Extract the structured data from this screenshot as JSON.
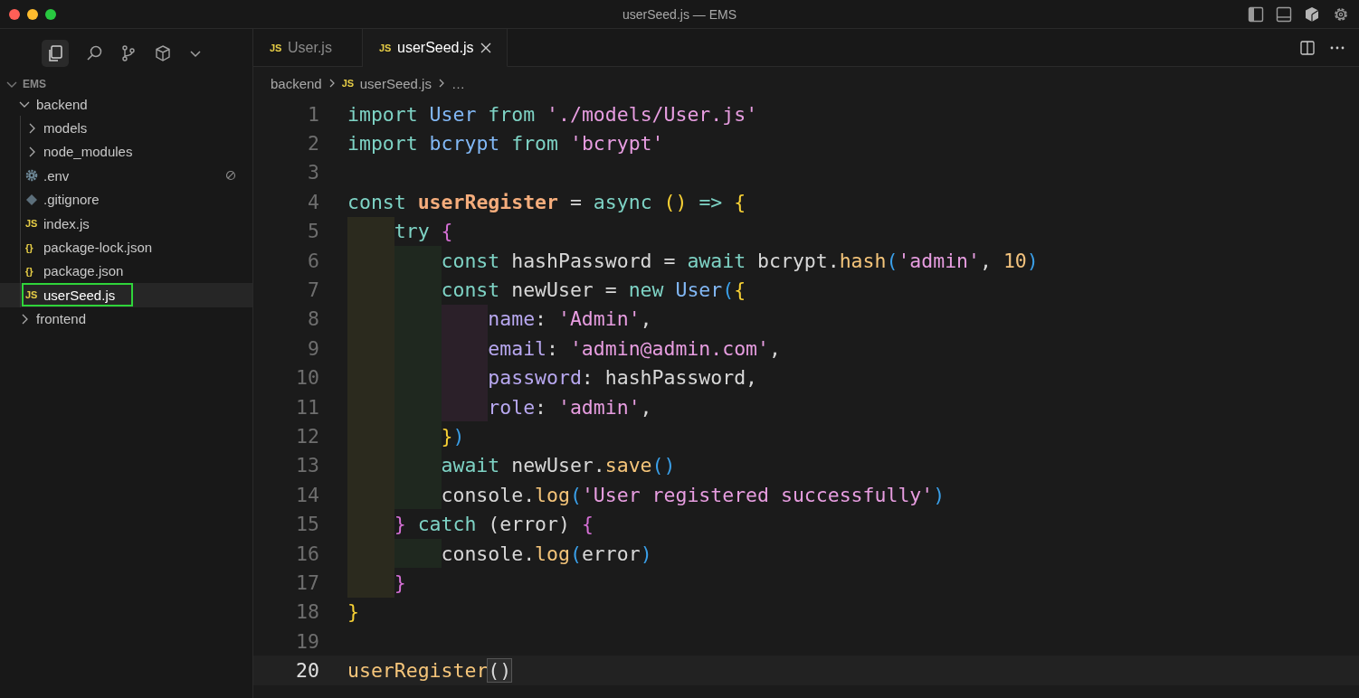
{
  "window": {
    "title": "userSeed.js — EMS"
  },
  "explorer": {
    "title": "EMS",
    "expanded": true,
    "tree": [
      {
        "name": "backend",
        "kind": "folder",
        "expanded": true,
        "selected": false,
        "children": [
          {
            "name": "models",
            "kind": "folder",
            "expanded": false,
            "selected": false
          },
          {
            "name": "node_modules",
            "kind": "folder",
            "expanded": false,
            "selected": false
          },
          {
            "name": ".env",
            "kind": "gear",
            "selected": false,
            "ignored": true
          },
          {
            "name": ".gitignore",
            "kind": "git",
            "selected": false,
            "ignored": false
          },
          {
            "name": "index.js",
            "kind": "file",
            "icon": "JS",
            "selected": false
          },
          {
            "name": "package-lock.json",
            "kind": "file",
            "icon": "{}",
            "selected": false
          },
          {
            "name": "package.json",
            "kind": "file",
            "icon": "{}",
            "selected": false
          },
          {
            "name": "userSeed.js",
            "kind": "file",
            "icon": "JS",
            "selected": true
          }
        ]
      },
      {
        "name": "frontend",
        "kind": "folder",
        "expanded": false,
        "selected": false
      }
    ]
  },
  "tabs": [
    {
      "icon": "JS",
      "label": "User.js",
      "selected": false
    },
    {
      "icon": "JS",
      "label": "userSeed.js",
      "selected": true
    }
  ],
  "breadcrumb": [
    {
      "label": "backend"
    },
    {
      "icon": "JS",
      "label": "userSeed.js"
    },
    {
      "label": "…"
    }
  ],
  "lines": [
    {
      "number": "1",
      "current": false,
      "tokens": [
        {
          "text": "import ",
          "kind": "kw"
        },
        {
          "text": "User ",
          "kind": "id"
        },
        {
          "text": "from ",
          "kind": "kw"
        },
        {
          "text": "'./models/User.js'",
          "kind": "str"
        }
      ]
    },
    {
      "number": "2",
      "current": false,
      "tokens": [
        {
          "text": "import ",
          "kind": "kw"
        },
        {
          "text": "bcrypt ",
          "kind": "id"
        },
        {
          "text": "from ",
          "kind": "kw"
        },
        {
          "text": "'bcrypt'",
          "kind": "str"
        }
      ]
    },
    {
      "number": "3",
      "current": false
    },
    {
      "number": "4",
      "current": false,
      "tokens": [
        {
          "text": "const ",
          "kind": "kw"
        },
        {
          "text": "userRegister",
          "kind": "fn"
        },
        {
          "text": " = ",
          "kind": "p"
        },
        {
          "text": "async ",
          "kind": "kw"
        },
        {
          "text": "() ",
          "kind": "b1"
        },
        {
          "text": "=> ",
          "kind": "kw"
        },
        {
          "text": "{",
          "kind": "b1"
        }
      ],
      "children": [
        {
          "number": "5",
          "current": false,
          "tokens": [
            {
              "text": "try ",
              "kind": "kw"
            },
            {
              "text": "{",
              "kind": "b2"
            }
          ],
          "children": [
            {
              "number": "6",
              "current": false,
              "tokens": [
                {
                  "text": "const ",
                  "kind": "kw"
                },
                {
                  "text": "hashPassword = ",
                  "kind": "p"
                },
                {
                  "text": "await ",
                  "kind": "kw"
                },
                {
                  "text": "bcrypt.",
                  "kind": "p"
                },
                {
                  "text": "hash",
                  "kind": "call"
                },
                {
                  "text": "(",
                  "kind": "b3"
                },
                {
                  "text": "'admin'",
                  "kind": "str"
                },
                {
                  "text": ", ",
                  "kind": "p"
                },
                {
                  "text": "10",
                  "kind": "num"
                },
                {
                  "text": ")",
                  "kind": "b3"
                }
              ]
            },
            {
              "number": "7",
              "current": false,
              "tokens": [
                {
                  "text": "const ",
                  "kind": "kw"
                },
                {
                  "text": "newUser = ",
                  "kind": "p"
                },
                {
                  "text": "new ",
                  "kind": "kw"
                },
                {
                  "text": "User",
                  "kind": "id"
                },
                {
                  "text": "(",
                  "kind": "b3"
                },
                {
                  "text": "{",
                  "kind": "b1"
                }
              ],
              "children": [
                {
                  "number": "8",
                  "current": false,
                  "tokens": [
                    {
                      "text": "name",
                      "kind": "prop"
                    },
                    {
                      "text": ": ",
                      "kind": "p"
                    },
                    {
                      "text": "'Admin'",
                      "kind": "str"
                    },
                    {
                      "text": ",",
                      "kind": "p"
                    }
                  ]
                },
                {
                  "number": "9",
                  "current": false,
                  "tokens": [
                    {
                      "text": "email",
                      "kind": "prop"
                    },
                    {
                      "text": ": ",
                      "kind": "p"
                    },
                    {
                      "text": "'admin@admin.com'",
                      "kind": "str"
                    },
                    {
                      "text": ",",
                      "kind": "p"
                    }
                  ]
                },
                {
                  "number": "10",
                  "current": false,
                  "tokens": [
                    {
                      "text": "password",
                      "kind": "prop"
                    },
                    {
                      "text": ": hashPassword,",
                      "kind": "p"
                    }
                  ]
                },
                {
                  "number": "11",
                  "current": false,
                  "tokens": [
                    {
                      "text": "role",
                      "kind": "prop"
                    },
                    {
                      "text": ": ",
                      "kind": "p"
                    },
                    {
                      "text": "'admin'",
                      "kind": "str"
                    },
                    {
                      "text": ",",
                      "kind": "p"
                    }
                  ]
                }
              ]
            },
            {
              "number": "12",
              "current": false,
              "tokens": [
                {
                  "text": "}",
                  "kind": "b1"
                },
                {
                  "text": ")",
                  "kind": "b3"
                }
              ]
            },
            {
              "number": "13",
              "current": false,
              "tokens": [
                {
                  "text": "await ",
                  "kind": "kw"
                },
                {
                  "text": "newUser.",
                  "kind": "p"
                },
                {
                  "text": "save",
                  "kind": "call"
                },
                {
                  "text": "()",
                  "kind": "b3"
                }
              ]
            },
            {
              "number": "14",
              "current": false,
              "tokens": [
                {
                  "text": "console.",
                  "kind": "p"
                },
                {
                  "text": "log",
                  "kind": "call"
                },
                {
                  "text": "(",
                  "kind": "b3"
                },
                {
                  "text": "'User registered successfully'",
                  "kind": "str"
                },
                {
                  "text": ")",
                  "kind": "b3"
                }
              ]
            }
          ]
        },
        {
          "number": "15",
          "current": false,
          "tokens": [
            {
              "text": "} ",
              "kind": "b2"
            },
            {
              "text": "catch ",
              "kind": "kw"
            },
            {
              "text": "(error) ",
              "kind": "p"
            },
            {
              "text": "{",
              "kind": "b2"
            }
          ],
          "children": [
            {
              "number": "16",
              "current": false,
              "tokens": [
                {
                  "text": "console.",
                  "kind": "p"
                },
                {
                  "text": "log",
                  "kind": "call"
                },
                {
                  "text": "(",
                  "kind": "b3"
                },
                {
                  "text": "error",
                  "kind": "p"
                },
                {
                  "text": ")",
                  "kind": "b3"
                }
              ]
            }
          ]
        },
        {
          "number": "17",
          "current": false,
          "tokens": [
            {
              "text": "}",
              "kind": "b2"
            }
          ]
        }
      ]
    },
    {
      "number": "18",
      "current": false,
      "tokens": [
        {
          "text": "}",
          "kind": "b1"
        }
      ]
    },
    {
      "number": "19",
      "current": false
    },
    {
      "number": "20",
      "current": true,
      "tokens": [
        {
          "text": "userRegister",
          "kind": "call"
        },
        {
          "text": "()",
          "kind": "match"
        }
      ]
    }
  ]
}
